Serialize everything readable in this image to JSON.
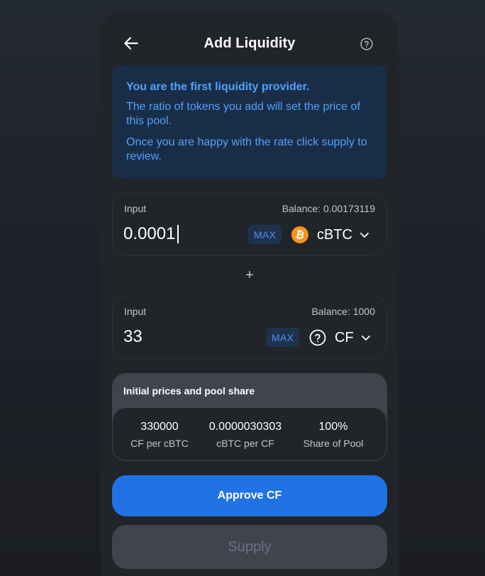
{
  "header": {
    "title": "Add Liquidity",
    "back_icon": "arrow-left-icon",
    "help_icon": "question-circle-icon"
  },
  "info": {
    "title": "You are the first liquidity provider.",
    "line1": "The ratio of tokens you add will set the price of this pool.",
    "line2": "Once you are happy with the rate click supply to review."
  },
  "input_a": {
    "label": "Input",
    "balance": "Balance: 0.00173119",
    "value": "0.0001",
    "max_label": "MAX",
    "token": "cBTC",
    "token_icon": "bitcoin-icon"
  },
  "plus": "+",
  "input_b": {
    "label": "Input",
    "balance": "Balance: 1000",
    "value": "33",
    "max_label": "MAX",
    "token": "CF",
    "token_icon": "question-circle-icon"
  },
  "prices": {
    "title": "Initial prices and pool share",
    "items": [
      {
        "value": "330000",
        "label": "CF per cBTC"
      },
      {
        "value": "0.0000030303",
        "label": "cBTC per CF"
      },
      {
        "value": "100%",
        "label": "Share of Pool"
      }
    ]
  },
  "buttons": {
    "approve": "Approve CF",
    "supply": "Supply"
  },
  "colors": {
    "accent": "#2172e5",
    "info_bg": "#1a2d47",
    "info_text": "#4fa2ff",
    "bitcoin": "#f7931a",
    "card_bg": "#212429"
  }
}
